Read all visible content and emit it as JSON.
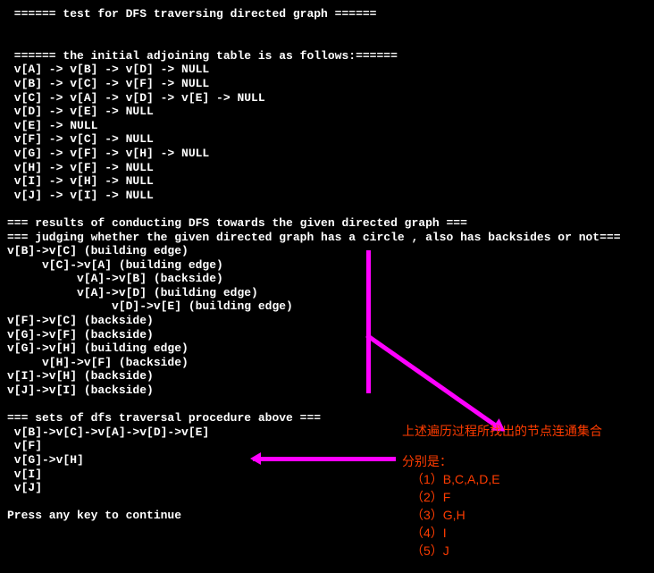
{
  "title": " ====== test for DFS traversing directed graph ======",
  "adj_header": " ====== the initial adjoining table is as follows:======",
  "adj": [
    " v[A] -> v[B] -> v[D] -> NULL",
    " v[B] -> v[C] -> v[F] -> NULL",
    " v[C] -> v[A] -> v[D] -> v[E] -> NULL",
    " v[D] -> v[E] -> NULL",
    " v[E] -> NULL",
    " v[F] -> v[C] -> NULL",
    " v[G] -> v[F] -> v[H] -> NULL",
    " v[H] -> v[F] -> NULL",
    " v[I] -> v[H] -> NULL",
    " v[J] -> v[I] -> NULL"
  ],
  "dfs_header1": "=== results of conducting DFS towards the given directed graph ===",
  "dfs_header2": "=== judging whether the given directed graph has a circle , also has backsides or not===",
  "dfs_lines": [
    "v[B]->v[C] (building edge)",
    "     v[C]->v[A] (building edge)",
    "          v[A]->v[B] (backside)",
    "          v[A]->v[D] (building edge)",
    "               v[D]->v[E] (building edge)",
    "v[F]->v[C] (backside)",
    "v[G]->v[F] (backside)",
    "v[G]->v[H] (building edge)",
    "     v[H]->v[F] (backside)",
    "v[I]->v[H] (backside)",
    "v[J]->v[I] (backside)"
  ],
  "sets_header": "=== sets of dfs traversal procedure above ===",
  "sets": [
    " v[B]->v[C]->v[A]->v[D]->v[E]",
    " v[F]",
    " v[G]->v[H]",
    " v[I]",
    " v[J]"
  ],
  "prompt": "Press any key to continue",
  "anno": {
    "head": "上述遍历过程所找出的节点连通集合",
    "sub": "分别是：",
    "items": [
      "（1）B,C,A,D,E",
      "（2）F",
      "（3）G,H",
      "（4）I",
      "（5）J"
    ]
  }
}
